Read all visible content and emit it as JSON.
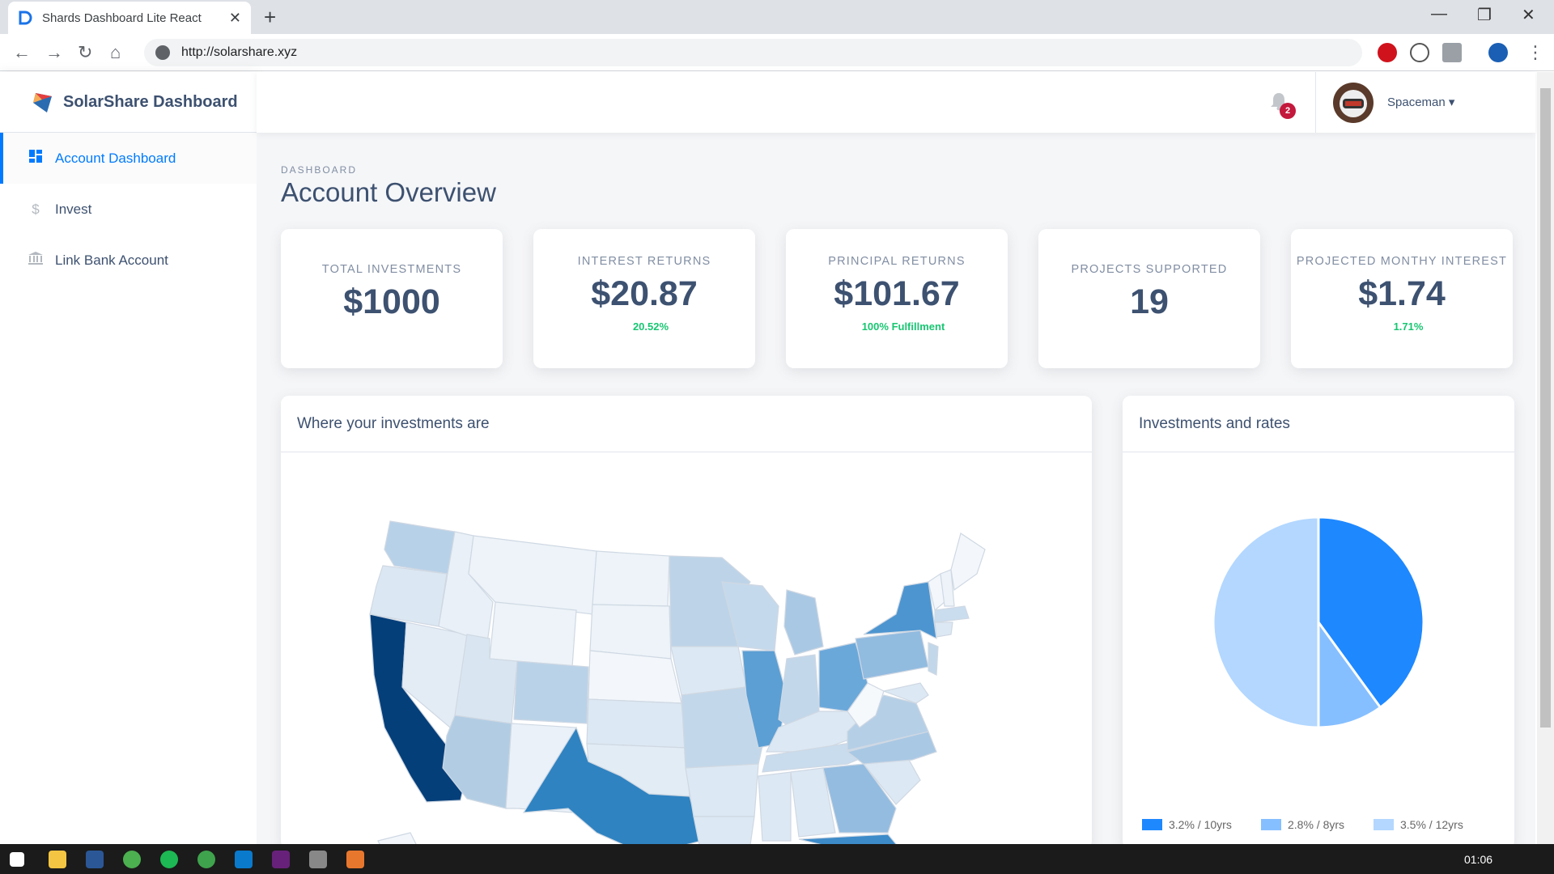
{
  "browser": {
    "tab_title": "Shards Dashboard Lite React",
    "url": "http://solarshare.xyz"
  },
  "sidebar": {
    "brand": "SolarShare Dashboard",
    "items": [
      {
        "label": "Account Dashboard",
        "icon": "dashboard-icon",
        "active": true
      },
      {
        "label": "Invest",
        "icon": "dollar-icon",
        "active": false
      },
      {
        "label": "Link Bank Account",
        "icon": "bank-icon",
        "active": false
      }
    ]
  },
  "topnav": {
    "notification_count": "2",
    "username": "Spaceman"
  },
  "page": {
    "subtitle": "DASHBOARD",
    "title": "Account Overview"
  },
  "stats": [
    {
      "label": "TOTAL INVESTMENTS",
      "value": "$1000",
      "sub": ""
    },
    {
      "label": "INTEREST RETURNS",
      "value": "$20.87",
      "sub": "20.52%"
    },
    {
      "label": "PRINCIPAL RETURNS",
      "value": "$101.67",
      "sub": "100% Fulfillment"
    },
    {
      "label": "PROJECTS SUPPORTED",
      "value": "19",
      "sub": ""
    },
    {
      "label": "PROJECTED MONTHY INTEREST",
      "value": "$1.74",
      "sub": "1.71%"
    }
  ],
  "map_card": {
    "title": "Where your investments are"
  },
  "pie_card": {
    "title": "Investments and rates"
  },
  "chart_data": {
    "type": "pie",
    "categories": [
      "3.2% / 10yrs",
      "2.8% / 8yrs",
      "3.5% / 12yrs"
    ],
    "values": [
      40,
      10,
      50
    ],
    "colors": [
      "#1e88ff",
      "#86bfff",
      "#b3d7ff"
    ],
    "legend": "bottom"
  },
  "taskbar": {
    "clock": "01:06"
  }
}
